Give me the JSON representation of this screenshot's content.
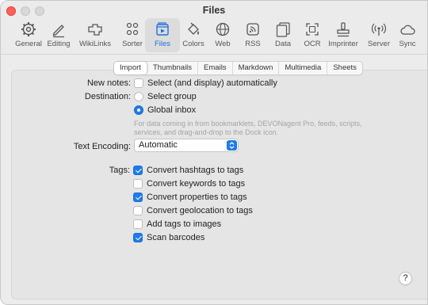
{
  "window": {
    "title": "Files"
  },
  "toolbar": {
    "items": [
      {
        "label": "General",
        "icon": "gear-icon"
      },
      {
        "label": "Editing",
        "icon": "pencil-icon"
      },
      {
        "label": "WikiLinks",
        "icon": "wikilinks-icon"
      },
      {
        "label": "Sorter",
        "icon": "sorter-icon"
      },
      {
        "label": "Files",
        "icon": "files-icon",
        "selected": true
      },
      {
        "label": "Colors",
        "icon": "paint-bucket-icon"
      },
      {
        "label": "Web",
        "icon": "globe-icon"
      },
      {
        "label": "RSS",
        "icon": "rss-icon"
      },
      {
        "label": "Data",
        "icon": "data-icon"
      },
      {
        "label": "OCR",
        "icon": "ocr-icon"
      },
      {
        "label": "Imprinter",
        "icon": "stamp-icon"
      },
      {
        "label": "Server",
        "icon": "antenna-icon"
      },
      {
        "label": "Sync",
        "icon": "cloud-icon"
      }
    ]
  },
  "tabs": [
    {
      "label": "Import",
      "active": true
    },
    {
      "label": "Thumbnails"
    },
    {
      "label": "Emails"
    },
    {
      "label": "Markdown"
    },
    {
      "label": "Multimedia"
    },
    {
      "label": "Sheets"
    }
  ],
  "new_notes": {
    "label": "New notes:",
    "option": "Select (and display) automatically",
    "checked": false
  },
  "destination": {
    "label": "Destination:",
    "options": [
      {
        "label": "Select group",
        "selected": false
      },
      {
        "label": "Global inbox",
        "selected": true
      }
    ],
    "hint_line1": "For data coming in from bookmarklets, DEVONagent Pro, feeds, scripts,",
    "hint_line2": "services, and drag-and-drop to the Dock icon."
  },
  "encoding": {
    "label": "Text Encoding:",
    "value": "Automatic"
  },
  "tags": {
    "label": "Tags:",
    "options": [
      {
        "label": "Convert hashtags to tags",
        "checked": true
      },
      {
        "label": "Convert keywords to tags",
        "checked": false
      },
      {
        "label": "Convert properties to tags",
        "checked": true
      },
      {
        "label": "Convert geolocation to tags",
        "checked": false
      },
      {
        "label": "Add tags to images",
        "checked": false
      },
      {
        "label": "Scan barcodes",
        "checked": true
      }
    ]
  },
  "help": {
    "label": "?"
  },
  "colors": {
    "accent": "#1f7aea",
    "close": "#fe5f57"
  }
}
